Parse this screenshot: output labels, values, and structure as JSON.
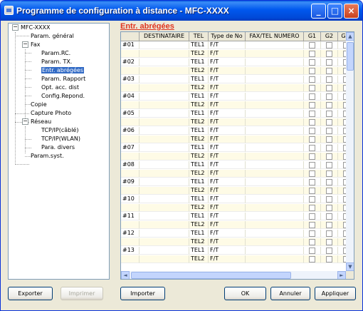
{
  "window": {
    "title": "Programme de configuration à distance - MFC-XXXX",
    "controls": {
      "minimize": "_",
      "maximize": "□",
      "close": "×"
    }
  },
  "tree": {
    "root": "MFC-XXXX",
    "items": [
      {
        "label": "Param. général"
      },
      {
        "label": "Fax"
      },
      {
        "label": "Param.RC."
      },
      {
        "label": "Param. TX."
      },
      {
        "label": "Entr. abrégées"
      },
      {
        "label": "Param. Rapport"
      },
      {
        "label": "Opt. acc. dist"
      },
      {
        "label": "Config.Repond."
      },
      {
        "label": "Copie"
      },
      {
        "label": "Capture Photo"
      },
      {
        "label": "Réseau"
      },
      {
        "label": "TCP/IP(câblé)"
      },
      {
        "label": "TCP/IP(WLAN)"
      },
      {
        "label": "Para. divers"
      },
      {
        "label": "Param.syst."
      }
    ],
    "expander_open": "−"
  },
  "section_title": "Entr. abrégées",
  "grid": {
    "columns": [
      "",
      "DESTINATAIRE",
      "TEL",
      "Type de No",
      "FAX/TEL NUMERO",
      "G1",
      "G2",
      "G"
    ],
    "rows": [
      {
        "id": "#01",
        "tel1": "TEL1",
        "tel2": "TEL2",
        "type1": "F/T",
        "type2": "F/T"
      },
      {
        "id": "#02",
        "tel1": "TEL1",
        "tel2": "TEL2",
        "type1": "F/T",
        "type2": "F/T"
      },
      {
        "id": "#03",
        "tel1": "TEL1",
        "tel2": "TEL2",
        "type1": "F/T",
        "type2": "F/T"
      },
      {
        "id": "#04",
        "tel1": "TEL1",
        "tel2": "TEL2",
        "type1": "F/T",
        "type2": "F/T"
      },
      {
        "id": "#05",
        "tel1": "TEL1",
        "tel2": "TEL2",
        "type1": "F/T",
        "type2": "F/T"
      },
      {
        "id": "#06",
        "tel1": "TEL1",
        "tel2": "TEL2",
        "type1": "F/T",
        "type2": "F/T"
      },
      {
        "id": "#07",
        "tel1": "TEL1",
        "tel2": "TEL2",
        "type1": "F/T",
        "type2": "F/T"
      },
      {
        "id": "#08",
        "tel1": "TEL1",
        "tel2": "TEL2",
        "type1": "F/T",
        "type2": "F/T"
      },
      {
        "id": "#09",
        "tel1": "TEL1",
        "tel2": "TEL2",
        "type1": "F/T",
        "type2": "F/T"
      },
      {
        "id": "#10",
        "tel1": "TEL1",
        "tel2": "TEL2",
        "type1": "F/T",
        "type2": "F/T"
      },
      {
        "id": "#11",
        "tel1": "TEL1",
        "tel2": "TEL2",
        "type1": "F/T",
        "type2": "F/T"
      },
      {
        "id": "#12",
        "tel1": "TEL1",
        "tel2": "TEL2",
        "type1": "F/T",
        "type2": "F/T"
      },
      {
        "id": "#13",
        "tel1": "TEL1",
        "tel2": "TEL2",
        "type1": "F/T",
        "type2": "F/T"
      }
    ],
    "scroll": {
      "up": "▲",
      "down": "▼",
      "left": "◄",
      "right": "►"
    }
  },
  "buttons": {
    "export": "Exporter",
    "print": "Imprimer",
    "import": "Importer",
    "ok": "OK",
    "cancel": "Annuler",
    "apply": "Appliquer"
  },
  "colors": {
    "title_bar": "#0058ee",
    "section_title": "#e0351f",
    "selection": "#316ac5",
    "tel2_row_bg": "#fefbe6"
  }
}
